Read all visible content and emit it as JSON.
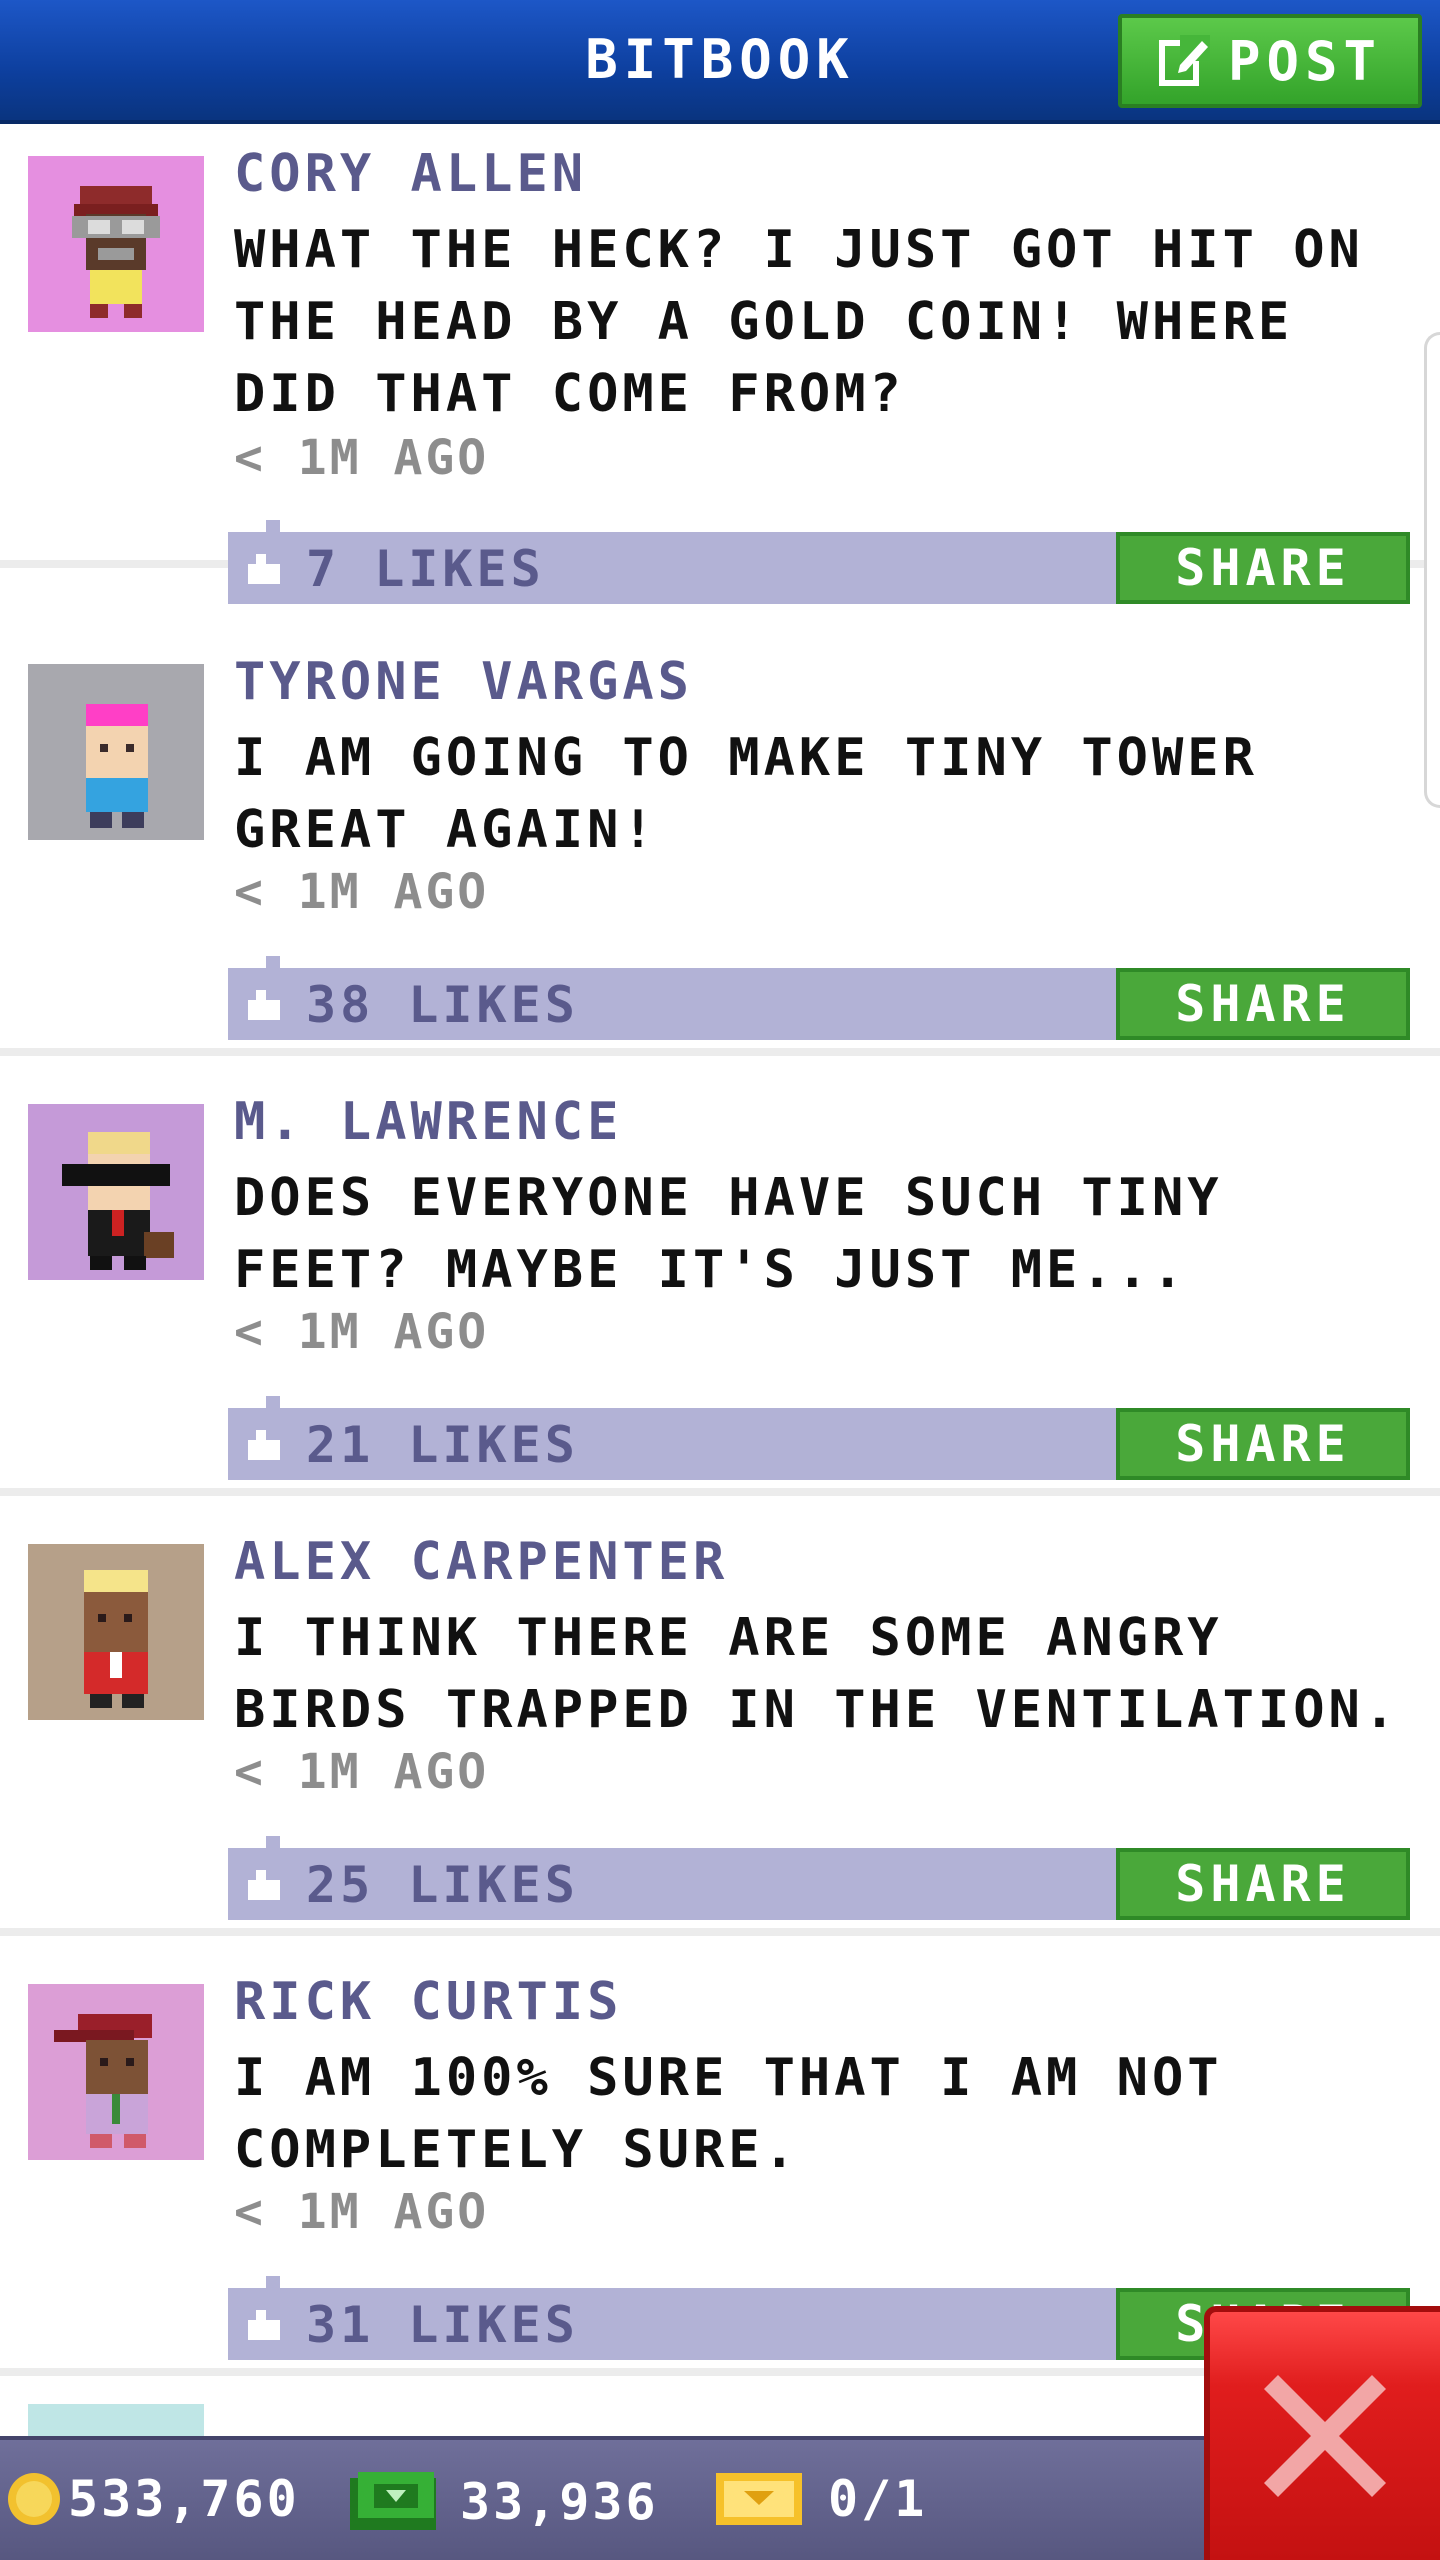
{
  "header": {
    "title": "BITBOOK",
    "post_label": "POST"
  },
  "posts": [
    {
      "author": "CORY ALLEN",
      "message": "WHAT THE HECK? I JUST GOT HIT ON THE HEAD BY A GOLD COIN! WHERE DID THAT COME FROM?",
      "time": "< 1M AGO",
      "likes": "7 LIKES",
      "share_label": "SHARE",
      "avatar_bg": "#e58fe0"
    },
    {
      "author": "TYRONE VARGAS",
      "message": "I AM GOING TO MAKE TINY TOWER GREAT AGAIN!",
      "time": "< 1M AGO",
      "likes": "38 LIKES",
      "share_label": "SHARE",
      "avatar_bg": "#a8a8ae"
    },
    {
      "author": "M. LAWRENCE",
      "message": "DOES EVERYONE HAVE SUCH TINY FEET? MAYBE IT'S JUST ME...",
      "time": "< 1M AGO",
      "likes": "21 LIKES",
      "share_label": "SHARE",
      "avatar_bg": "#c59ad8"
    },
    {
      "author": "ALEX CARPENTER",
      "message": "I THINK THERE ARE SOME ANGRY BIRDS TRAPPED IN THE VENTILATION.",
      "time": "< 1M AGO",
      "likes": "25 LIKES",
      "share_label": "SHARE",
      "avatar_bg": "#b6a089"
    },
    {
      "author": "RICK CURTIS",
      "message": "I AM 100% SURE THAT I AM NOT COMPLETELY SURE.",
      "time": "< 1M AGO",
      "likes": "31 LIKES",
      "share_label": "SHARE",
      "avatar_bg": "#dc9ed6"
    }
  ],
  "footer": {
    "coins": "533,760",
    "bux": "33,936",
    "tickets": "0/1"
  },
  "colors": {
    "header_blue": "#0d3f9e",
    "share_green": "#4aa83a",
    "like_bar": "#b2b2d6",
    "close_red": "#e01d1d"
  },
  "icons": {
    "post": "edit-icon",
    "like": "thumbs-up-icon",
    "coin": "coin-icon",
    "bux": "bux-icon",
    "ticket": "ticket-icon",
    "close": "close-icon"
  }
}
